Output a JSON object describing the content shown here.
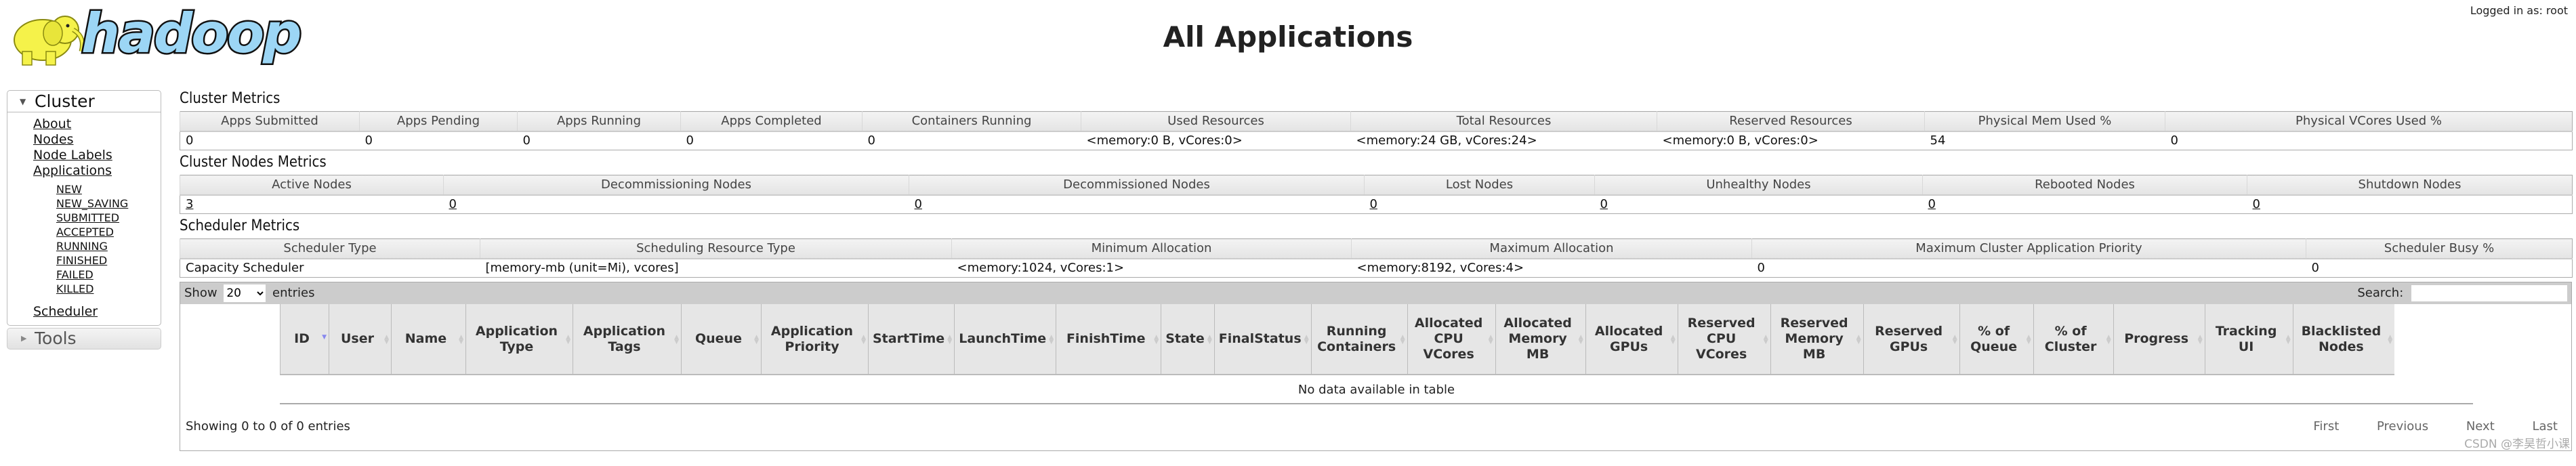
{
  "header": {
    "logo_text": "hadoop",
    "title": "All Applications",
    "logged_in": "Logged in as: root"
  },
  "sidebar": {
    "cluster_label": "Cluster",
    "cluster_links": [
      "About",
      "Nodes",
      "Node Labels",
      "Applications"
    ],
    "app_states": [
      "NEW",
      "NEW_SAVING",
      "SUBMITTED",
      "ACCEPTED",
      "RUNNING",
      "FINISHED",
      "FAILED",
      "KILLED"
    ],
    "scheduler_label": "Scheduler",
    "tools_label": "Tools"
  },
  "cluster_metrics": {
    "title": "Cluster Metrics",
    "headers": [
      "Apps Submitted",
      "Apps Pending",
      "Apps Running",
      "Apps Completed",
      "Containers Running",
      "Used Resources",
      "Total Resources",
      "Reserved Resources",
      "Physical Mem Used %",
      "Physical VCores Used %"
    ],
    "values": [
      "0",
      "0",
      "0",
      "0",
      "0",
      "<memory:0 B, vCores:0>",
      "<memory:24 GB, vCores:24>",
      "<memory:0 B, vCores:0>",
      "54",
      "0"
    ]
  },
  "node_metrics": {
    "title": "Cluster Nodes Metrics",
    "headers": [
      "Active Nodes",
      "Decommissioning Nodes",
      "Decommissioned Nodes",
      "Lost Nodes",
      "Unhealthy Nodes",
      "Rebooted Nodes",
      "Shutdown Nodes"
    ],
    "values": [
      "3",
      "0",
      "0",
      "0",
      "0",
      "0",
      "0"
    ]
  },
  "scheduler_metrics": {
    "title": "Scheduler Metrics",
    "headers": [
      "Scheduler Type",
      "Scheduling Resource Type",
      "Minimum Allocation",
      "Maximum Allocation",
      "Maximum Cluster Application Priority",
      "Scheduler Busy %"
    ],
    "values": [
      "Capacity Scheduler",
      "[memory-mb (unit=Mi), vcores]",
      "<memory:1024, vCores:1>",
      "<memory:8192, vCores:4>",
      "0",
      "0"
    ]
  },
  "apps": {
    "show_label": "Show",
    "page_size": "20",
    "entries_label": "entries",
    "search_label": "Search:",
    "search_value": "",
    "columns": [
      "ID",
      "User",
      "Name",
      "Application Type",
      "Application Tags",
      "Queue",
      "Application Priority",
      "StartTime",
      "LaunchTime",
      "FinishTime",
      "State",
      "FinalStatus",
      "Running Containers",
      "Allocated CPU VCores",
      "Allocated Memory MB",
      "Allocated GPUs",
      "Reserved CPU VCores",
      "Reserved Memory MB",
      "Reserved GPUs",
      "% of Queue",
      "% of Cluster",
      "Progress",
      "Tracking UI",
      "Blacklisted Nodes"
    ],
    "sorted_column": "ID",
    "empty_message": "No data available in table",
    "info": "Showing 0 to 0 of 0 entries",
    "paging": [
      "First",
      "Previous",
      "Next",
      "Last"
    ]
  },
  "watermark": "CSDN @李昊哲小课"
}
